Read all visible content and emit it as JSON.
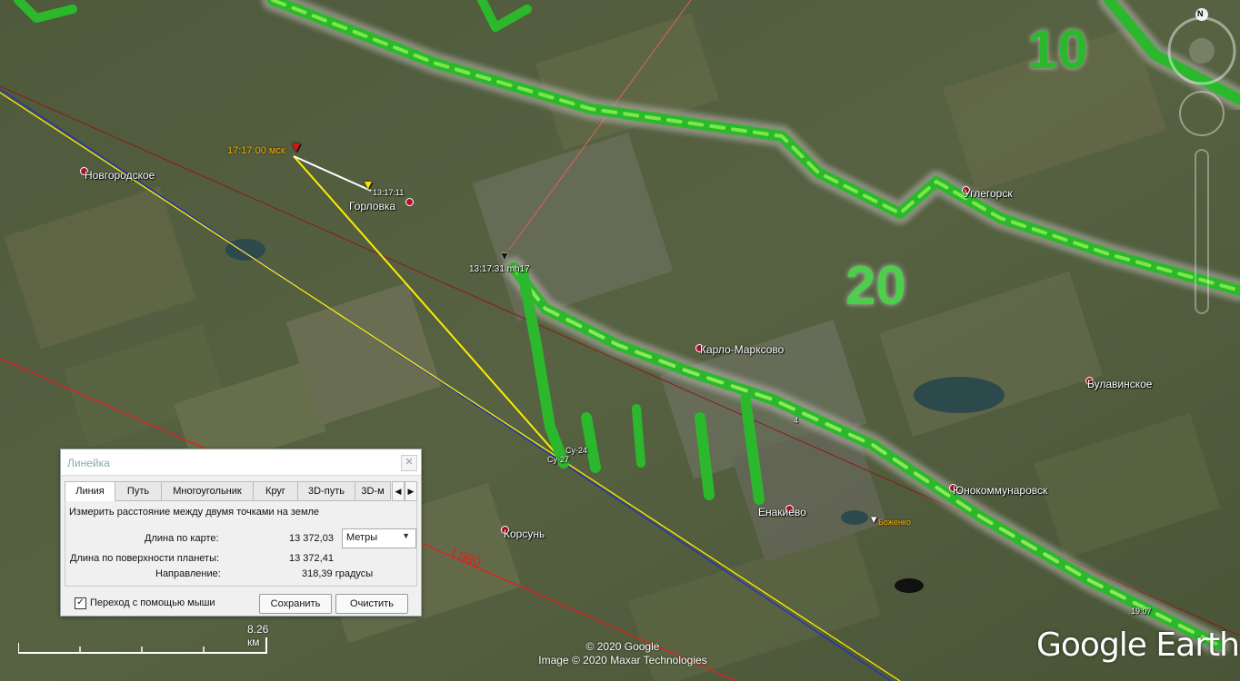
{
  "map": {
    "places": [
      {
        "key": "novgorodskoe",
        "label": "Новгородское"
      },
      {
        "key": "gorlovka",
        "label": "Горловка"
      },
      {
        "key": "uglegorsk",
        "label": "Углегорск"
      },
      {
        "key": "karlo_marksovo",
        "label": "Карло-Марксово"
      },
      {
        "key": "bulavinskoe",
        "label": "Булавинское"
      },
      {
        "key": "yunokommunarovsk",
        "label": "Юнокоммунаровск"
      },
      {
        "key": "enakievo",
        "label": "Енакиево"
      },
      {
        "key": "korsun",
        "label": "Корсунь"
      },
      {
        "key": "bozhenko",
        "label": "Боженко"
      }
    ],
    "markers": {
      "time_msk": "17:17:00 мск",
      "time_1311": "13:17:11",
      "time_mh17": "13:17:31 mh17",
      "su24": "Су-24",
      "su27": "Су-27",
      "num4": "4",
      "time_1907": "19:07",
      "route_label": "L980"
    },
    "radar_labels": [
      "10",
      "20"
    ],
    "compass_letter": "N",
    "colors": {
      "yellow_line": "#ffee00",
      "blue_line": "#2030c0",
      "red_line": "#e02020",
      "track_green": "#3ad63a"
    }
  },
  "ruler": {
    "title": "Линейка",
    "tabs": [
      "Линия",
      "Путь",
      "Многоугольник",
      "Круг",
      "3D-путь",
      "3D-м"
    ],
    "active_tab": "Линия",
    "description": "Измерить расстояние между двумя точками на земле",
    "map_length_label": "Длина по карте:",
    "map_length_value": "13 372,03",
    "units": "Метры",
    "surface_length_label": "Длина по поверхности планеты:",
    "surface_length_value": "13 372,41",
    "heading_label": "Направление:",
    "heading_value": "318,39 градусы",
    "mouse_nav_label": "Переход с помощью мыши",
    "mouse_nav_checked": true,
    "save_label": "Сохранить",
    "clear_label": "Очистить"
  },
  "scale": "8.26 км",
  "copyright": [
    "© 2020 Google",
    "Image © 2020 Maxar Technologies"
  ],
  "logo": "Google Earth"
}
